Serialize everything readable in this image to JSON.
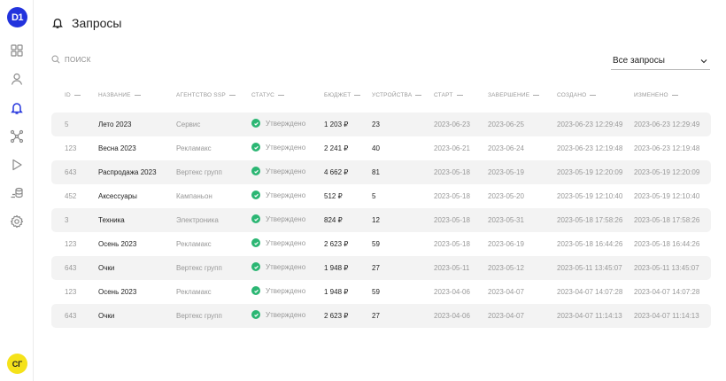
{
  "app": {
    "logo_text": "D1",
    "avatar_text": "СГ"
  },
  "sidebar": {
    "items": [
      {
        "name": "dashboard-icon"
      },
      {
        "name": "user-icon"
      },
      {
        "name": "bell-icon",
        "active": true
      },
      {
        "name": "network-icon"
      },
      {
        "name": "play-icon"
      },
      {
        "name": "database-icon"
      },
      {
        "name": "settings-icon"
      }
    ]
  },
  "header": {
    "title": "Запросы"
  },
  "search": {
    "placeholder": "поиск"
  },
  "filter": {
    "selected": "Все запросы"
  },
  "colors": {
    "accent": "#2233dd",
    "active_nav": "#2233dd",
    "status_ok": "#2bb673",
    "avatar_bg": "#f5e21a",
    "row_alt": "#f3f3f3"
  },
  "table": {
    "columns": [
      "ID",
      "Название",
      "Агентство SSP",
      "Статус",
      "Бюджет",
      "Устройства",
      "Старт",
      "Завершение",
      "Создано",
      "Изменено"
    ],
    "rows": [
      {
        "id": "5",
        "name": "Лето 2023",
        "agency": "Сервис",
        "status": "Утверждено",
        "budget": "1 203 ₽",
        "devices": "23",
        "start": "2023-06-23",
        "end": "2023-06-25",
        "created": "2023-06-23 12:29:49",
        "modified": "2023-06-23 12:29:49"
      },
      {
        "id": "123",
        "name": "Весна 2023",
        "agency": "Рекламакс",
        "status": "Утверждено",
        "budget": "2 241 ₽",
        "devices": "40",
        "start": "2023-06-21",
        "end": "2023-06-24",
        "created": "2023-06-23 12:19:48",
        "modified": "2023-06-23 12:19:48"
      },
      {
        "id": "643",
        "name": "Распродажа 2023",
        "agency": "Вертекс групп",
        "status": "Утверждено",
        "budget": "4 662 ₽",
        "devices": "81",
        "start": "2023-05-18",
        "end": "2023-05-19",
        "created": "2023-05-19 12:20:09",
        "modified": "2023-05-19 12:20:09"
      },
      {
        "id": "452",
        "name": "Аксессуары",
        "agency": "Кампаньон",
        "status": "Утверждено",
        "budget": "512 ₽",
        "devices": "5",
        "start": "2023-05-18",
        "end": "2023-05-20",
        "created": "2023-05-19 12:10:40",
        "modified": "2023-05-19 12:10:40"
      },
      {
        "id": "3",
        "name": "Техника",
        "agency": "Электроника",
        "status": "Утверждено",
        "budget": "824 ₽",
        "devices": "12",
        "start": "2023-05-18",
        "end": "2023-05-31",
        "created": "2023-05-18 17:58:26",
        "modified": "2023-05-18 17:58:26"
      },
      {
        "id": "123",
        "name": "Осень 2023",
        "agency": "Рекламакс",
        "status": "Утверждено",
        "budget": "2 623 ₽",
        "devices": "59",
        "start": "2023-05-18",
        "end": "2023-06-19",
        "created": "2023-05-18 16:44:26",
        "modified": "2023-05-18 16:44:26"
      },
      {
        "id": "643",
        "name": "Очки",
        "agency": "Вертекс групп",
        "status": "Утверждено",
        "budget": "1 948 ₽",
        "devices": "27",
        "start": "2023-05-11",
        "end": "2023-05-12",
        "created": "2023-05-11 13:45:07",
        "modified": "2023-05-11 13:45:07"
      },
      {
        "id": "123",
        "name": "Осень 2023",
        "agency": "Рекламакс",
        "status": "Утверждено",
        "budget": "1 948 ₽",
        "devices": "59",
        "start": "2023-04-06",
        "end": "2023-04-07",
        "created": "2023-04-07 14:07:28",
        "modified": "2023-04-07 14:07:28"
      },
      {
        "id": "643",
        "name": "Очки",
        "agency": "Вертекс групп",
        "status": "Утверждено",
        "budget": "2 623 ₽",
        "devices": "27",
        "start": "2023-04-06",
        "end": "2023-04-07",
        "created": "2023-04-07 11:14:13",
        "modified": "2023-04-07 11:14:13"
      }
    ]
  }
}
